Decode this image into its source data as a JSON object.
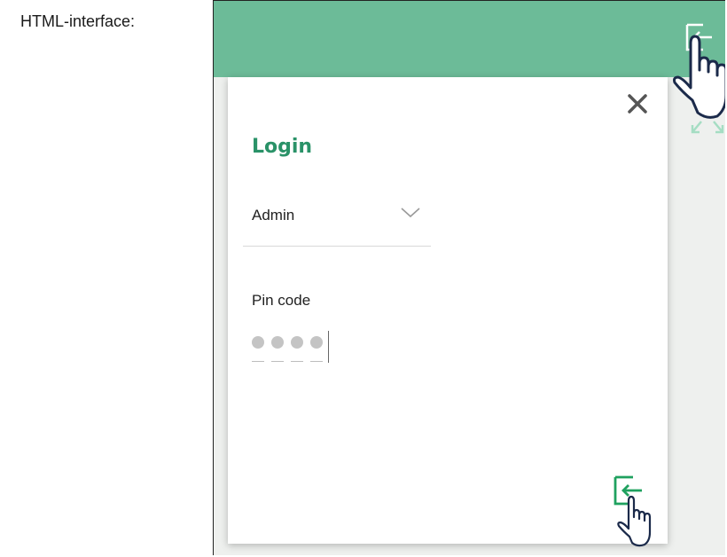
{
  "caption": "HTML-interface:",
  "login_panel": {
    "title": "Login",
    "user_select": {
      "value": "Admin"
    },
    "pin": {
      "label": "Pin code",
      "filled_digits": 4
    }
  },
  "colors": {
    "topbar": "#6cbb98",
    "accent": "#2a9268",
    "login_icon": "#1fa15f",
    "hand_stroke": "#1b2a4a"
  },
  "icons": {
    "topbar_login": "login-arrow-icon",
    "pointer": "hand-pointer-icon",
    "expand": "expand-arrows-icon",
    "close": "close-icon",
    "dropdown": "chevron-down-icon",
    "submit": "login-arrow-icon"
  }
}
